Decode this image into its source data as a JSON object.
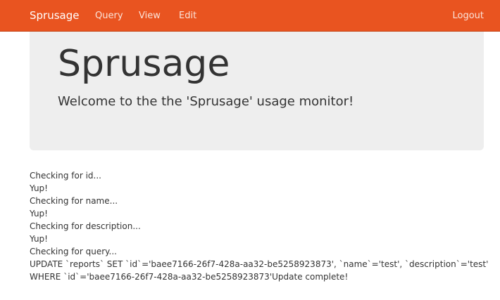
{
  "navbar": {
    "brand": "Sprusage",
    "items": [
      "Query",
      "View",
      "Edit"
    ],
    "logout": "Logout",
    "color": "#e95420"
  },
  "jumbotron": {
    "title": "Sprusage",
    "lead": "Welcome to the the 'Sprusage' usage monitor!"
  },
  "output": {
    "lines": [
      "Checking for id...",
      "Yup!",
      "Checking for name...",
      "Yup!",
      "Checking for description...",
      "Yup!",
      "Checking for query...",
      "UPDATE `reports` SET `id`='baee7166-26f7-428a-aa32-be5258923873', `name`='test', `description`='test'",
      "WHERE `id`='baee7166-26f7-428a-aa32-be5258923873'Update complete!"
    ]
  }
}
